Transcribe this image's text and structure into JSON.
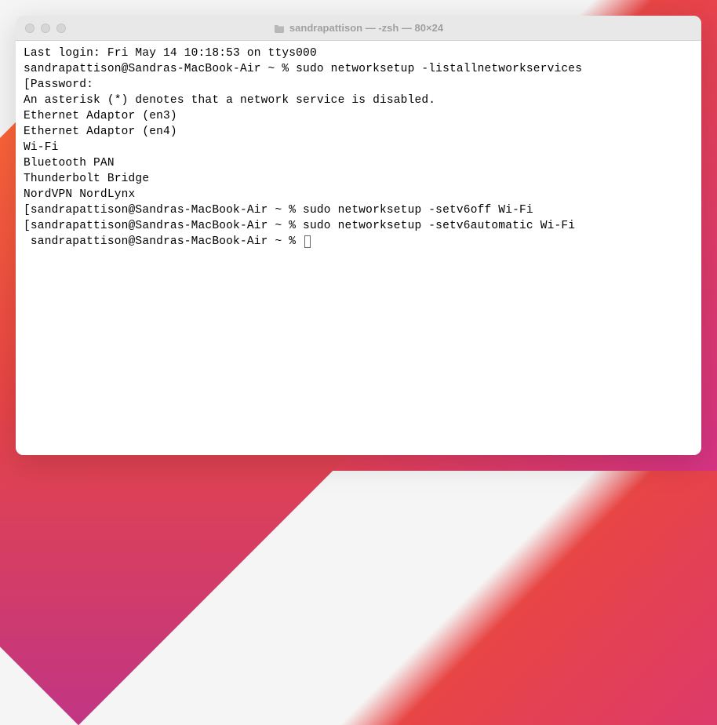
{
  "window": {
    "title": "sandrapattison — -zsh — 80×24"
  },
  "terminal": {
    "lines": [
      "Last login: Fri May 14 10:18:53 on ttys000",
      "sandrapattison@Sandras-MacBook-Air ~ % sudo networksetup -listallnetworkservices",
      "",
      "[Password:",
      "An asterisk (*) denotes that a network service is disabled.",
      "Ethernet Adaptor (en3)",
      "Ethernet Adaptor (en4)",
      "Wi-Fi",
      "Bluetooth PAN",
      "Thunderbolt Bridge",
      "NordVPN NordLynx",
      "[sandrapattison@Sandras-MacBook-Air ~ % sudo networksetup -setv6off Wi-Fi",
      "[sandrapattison@Sandras-MacBook-Air ~ % sudo networksetup -setv6automatic Wi-Fi",
      " sandrapattison@Sandras-MacBook-Air ~ % "
    ]
  }
}
